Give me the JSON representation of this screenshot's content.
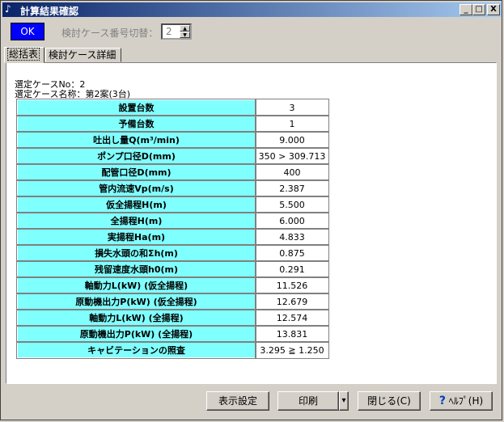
{
  "window": {
    "title": "計算結果確認",
    "min_label": "_",
    "max_label": "□",
    "close_label": "X"
  },
  "toolbar": {
    "ok_label": "OK",
    "case_switch_label": "検討ケース番号切替：",
    "case_number": "2"
  },
  "tabs": [
    {
      "label": "総括表"
    },
    {
      "label": "検討ケース詳細"
    }
  ],
  "summary": {
    "selected_case_no": "選定ケースNo：2",
    "selected_case_name": "選定ケース名称：第2案(3台)"
  },
  "table": {
    "rows": [
      {
        "label": "設置台数",
        "value": "3"
      },
      {
        "label": "予備台数",
        "value": "1"
      },
      {
        "label": "吐出し量Q(m³/min)",
        "value": "9.000"
      },
      {
        "label": "ポンプ口径D(mm)",
        "value": "350 > 309.713"
      },
      {
        "label": "配管口径D(mm)",
        "value": "400"
      },
      {
        "label": "管内流速Vp(m/s)",
        "value": "2.387"
      },
      {
        "label": "仮全揚程H(m)",
        "value": "5.500"
      },
      {
        "label": "全揚程H(m)",
        "value": "6.000"
      },
      {
        "label": "実揚程Ha(m)",
        "value": "4.833"
      },
      {
        "label": "損失水頭の和Σh(m)",
        "value": "0.875"
      },
      {
        "label": "残留速度水頭h0(m)",
        "value": "0.291"
      },
      {
        "label": "軸動力L(kW) (仮全揚程)",
        "value": "11.526"
      },
      {
        "label": "原動機出力P(kW) (仮全揚程)",
        "value": "12.679"
      },
      {
        "label": "軸動力L(kW) (全揚程)",
        "value": "12.574"
      },
      {
        "label": "原動機出力P(kW) (全揚程)",
        "value": "13.831"
      },
      {
        "label": "キャビテーションの照査",
        "value": "3.295 ≧ 1.250"
      }
    ]
  },
  "buttons": {
    "display_settings": "表示設定",
    "print": "印刷",
    "print_dropdown": "▾",
    "close": "閉じる(C)",
    "help_icon": "?",
    "help": "ﾍﾙﾌﾟ(H)"
  },
  "colors": {
    "accent": "#0000ff",
    "table_header": "#80ffff",
    "title_bar": "#0a246a"
  }
}
